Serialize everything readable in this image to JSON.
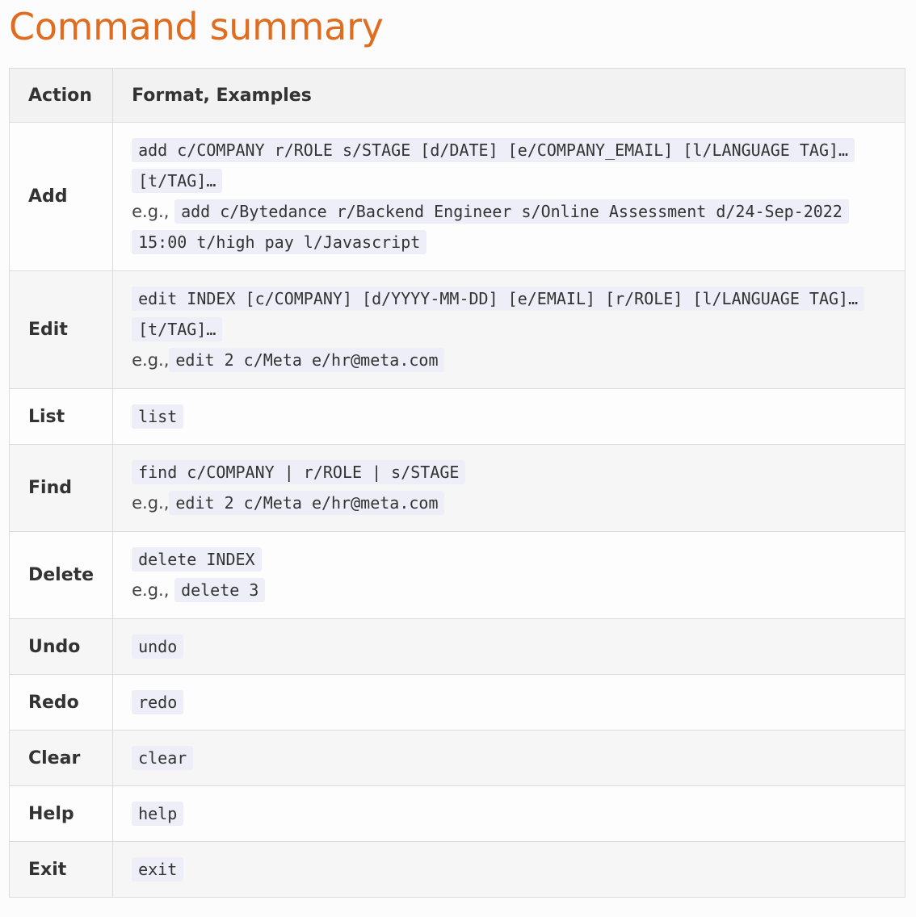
{
  "page": {
    "title": "Command summary"
  },
  "table": {
    "headers": {
      "action": "Action",
      "format": "Format, Examples"
    },
    "rows": [
      {
        "action": "Add",
        "format": "add c/COMPANY r/ROLE s/STAGE [d/DATE] [e/COMPANY_EMAIL] [l/LANGUAGE TAG]… [t/TAG]…",
        "example_prefix": "e.g.,",
        "example": "add c/Bytedance r/Backend Engineer s/Online Assessment d/24-Sep-2022 15:00 t/high pay l/Javascript"
      },
      {
        "action": "Edit",
        "format": "edit INDEX [c/COMPANY] [d/YYYY-MM-DD] [e/EMAIL] [r/ROLE] [l/LANGUAGE TAG]… [t/TAG]…",
        "example_prefix": "e.g.,",
        "example": "edit 2 c/Meta e/hr@meta.com"
      },
      {
        "action": "List",
        "format": "list"
      },
      {
        "action": "Find",
        "format": "find c/COMPANY | r/ROLE | s/STAGE",
        "example_prefix": "e.g.,",
        "example": "edit 2 c/Meta e/hr@meta.com"
      },
      {
        "action": "Delete",
        "format": "delete INDEX",
        "example_prefix": "e.g.,",
        "example": "delete 3"
      },
      {
        "action": "Undo",
        "format": "undo"
      },
      {
        "action": "Redo",
        "format": "redo"
      },
      {
        "action": "Clear",
        "format": "clear"
      },
      {
        "action": "Help",
        "format": "help"
      },
      {
        "action": "Exit",
        "format": "exit"
      }
    ]
  }
}
